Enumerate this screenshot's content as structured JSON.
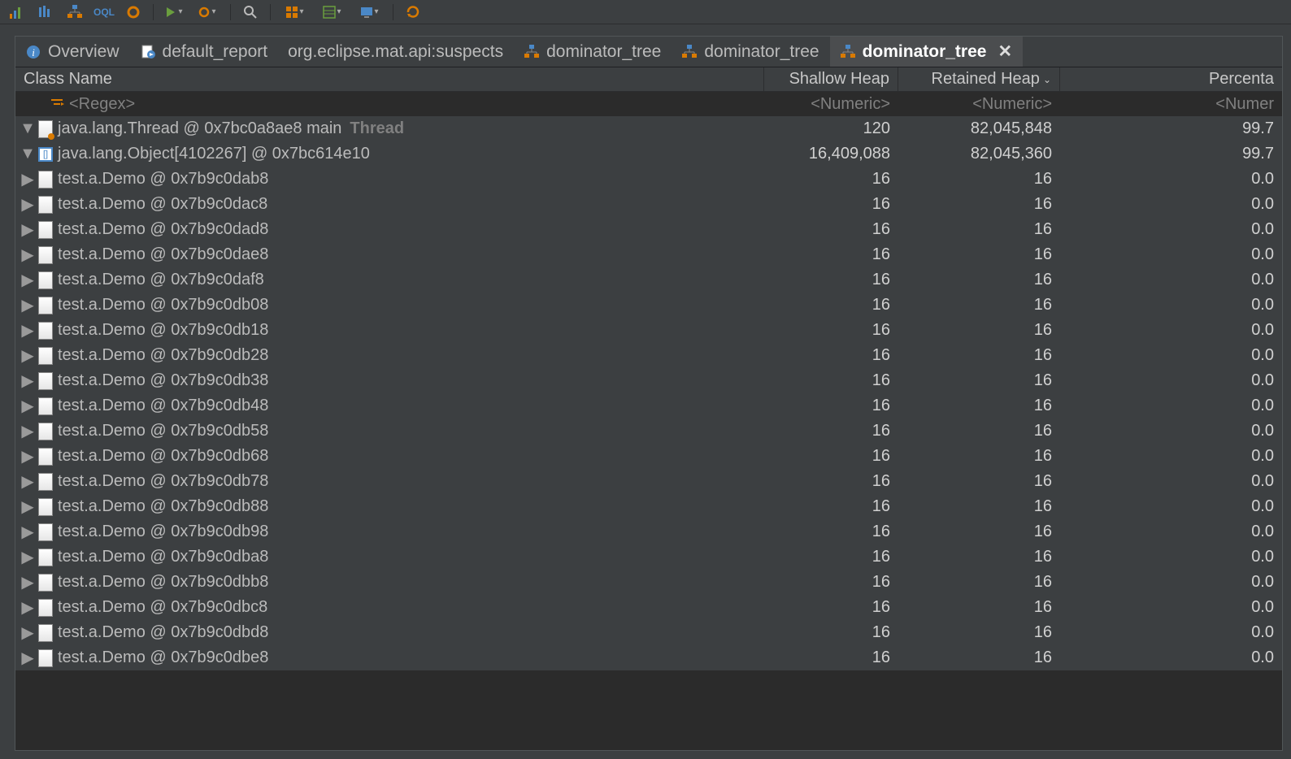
{
  "toolbar_icons": [
    "chart",
    "bars",
    "tree",
    "oql",
    "gear",
    "run",
    "rungear",
    "",
    "search",
    "",
    "grid",
    "table",
    "screen",
    "",
    "refresh"
  ],
  "tabs": [
    {
      "icon": "info",
      "label": "Overview"
    },
    {
      "icon": "report",
      "label": "default_report"
    },
    {
      "icon": "",
      "label": "org.eclipse.mat.api:suspects"
    },
    {
      "icon": "tree",
      "label": "dominator_tree"
    },
    {
      "icon": "tree",
      "label": "dominator_tree"
    },
    {
      "icon": "tree",
      "label": "dominator_tree",
      "active": true
    }
  ],
  "columns": {
    "name": "Class Name",
    "shallow": "Shallow Heap",
    "retained": "Retained Heap",
    "percent": "Percenta"
  },
  "filters": {
    "regex": "<Regex>",
    "numeric": "<Numeric>",
    "numer": "<Numer"
  },
  "thread_label": "Thread",
  "rows": [
    {
      "indent": 0,
      "expand": "down",
      "icon": "file-orange",
      "name": "java.lang.Thread @ 0x7bc0a8ae8  main",
      "thread": true,
      "shallow": "120",
      "retained": "82,045,848",
      "percent": "99.7"
    },
    {
      "indent": 1,
      "expand": "down",
      "icon": "array",
      "name": "java.lang.Object[4102267] @ 0x7bc614e10",
      "shallow": "16,409,088",
      "retained": "82,045,360",
      "percent": "99.7"
    },
    {
      "indent": 2,
      "expand": "right",
      "icon": "file",
      "name": "test.a.Demo @ 0x7b9c0dab8",
      "shallow": "16",
      "retained": "16",
      "percent": "0.0"
    },
    {
      "indent": 2,
      "expand": "right",
      "icon": "file",
      "name": "test.a.Demo @ 0x7b9c0dac8",
      "shallow": "16",
      "retained": "16",
      "percent": "0.0"
    },
    {
      "indent": 2,
      "expand": "right",
      "icon": "file",
      "name": "test.a.Demo @ 0x7b9c0dad8",
      "shallow": "16",
      "retained": "16",
      "percent": "0.0"
    },
    {
      "indent": 2,
      "expand": "right",
      "icon": "file",
      "name": "test.a.Demo @ 0x7b9c0dae8",
      "shallow": "16",
      "retained": "16",
      "percent": "0.0"
    },
    {
      "indent": 2,
      "expand": "right",
      "icon": "file",
      "name": "test.a.Demo @ 0x7b9c0daf8",
      "shallow": "16",
      "retained": "16",
      "percent": "0.0"
    },
    {
      "indent": 2,
      "expand": "right",
      "icon": "file",
      "name": "test.a.Demo @ 0x7b9c0db08",
      "shallow": "16",
      "retained": "16",
      "percent": "0.0"
    },
    {
      "indent": 2,
      "expand": "right",
      "icon": "file",
      "name": "test.a.Demo @ 0x7b9c0db18",
      "shallow": "16",
      "retained": "16",
      "percent": "0.0"
    },
    {
      "indent": 2,
      "expand": "right",
      "icon": "file",
      "name": "test.a.Demo @ 0x7b9c0db28",
      "shallow": "16",
      "retained": "16",
      "percent": "0.0"
    },
    {
      "indent": 2,
      "expand": "right",
      "icon": "file",
      "name": "test.a.Demo @ 0x7b9c0db38",
      "shallow": "16",
      "retained": "16",
      "percent": "0.0"
    },
    {
      "indent": 2,
      "expand": "right",
      "icon": "file",
      "name": "test.a.Demo @ 0x7b9c0db48",
      "shallow": "16",
      "retained": "16",
      "percent": "0.0"
    },
    {
      "indent": 2,
      "expand": "right",
      "icon": "file",
      "name": "test.a.Demo @ 0x7b9c0db58",
      "shallow": "16",
      "retained": "16",
      "percent": "0.0"
    },
    {
      "indent": 2,
      "expand": "right",
      "icon": "file",
      "name": "test.a.Demo @ 0x7b9c0db68",
      "shallow": "16",
      "retained": "16",
      "percent": "0.0"
    },
    {
      "indent": 2,
      "expand": "right",
      "icon": "file",
      "name": "test.a.Demo @ 0x7b9c0db78",
      "shallow": "16",
      "retained": "16",
      "percent": "0.0"
    },
    {
      "indent": 2,
      "expand": "right",
      "icon": "file",
      "name": "test.a.Demo @ 0x7b9c0db88",
      "shallow": "16",
      "retained": "16",
      "percent": "0.0"
    },
    {
      "indent": 2,
      "expand": "right",
      "icon": "file",
      "name": "test.a.Demo @ 0x7b9c0db98",
      "shallow": "16",
      "retained": "16",
      "percent": "0.0"
    },
    {
      "indent": 2,
      "expand": "right",
      "icon": "file",
      "name": "test.a.Demo @ 0x7b9c0dba8",
      "shallow": "16",
      "retained": "16",
      "percent": "0.0"
    },
    {
      "indent": 2,
      "expand": "right",
      "icon": "file",
      "name": "test.a.Demo @ 0x7b9c0dbb8",
      "shallow": "16",
      "retained": "16",
      "percent": "0.0"
    },
    {
      "indent": 2,
      "expand": "right",
      "icon": "file",
      "name": "test.a.Demo @ 0x7b9c0dbc8",
      "shallow": "16",
      "retained": "16",
      "percent": "0.0"
    },
    {
      "indent": 2,
      "expand": "right",
      "icon": "file",
      "name": "test.a.Demo @ 0x7b9c0dbd8",
      "shallow": "16",
      "retained": "16",
      "percent": "0.0"
    },
    {
      "indent": 2,
      "expand": "right",
      "icon": "file",
      "name": "test.a.Demo @ 0x7b9c0dbe8",
      "shallow": "16",
      "retained": "16",
      "percent": "0.0"
    }
  ]
}
